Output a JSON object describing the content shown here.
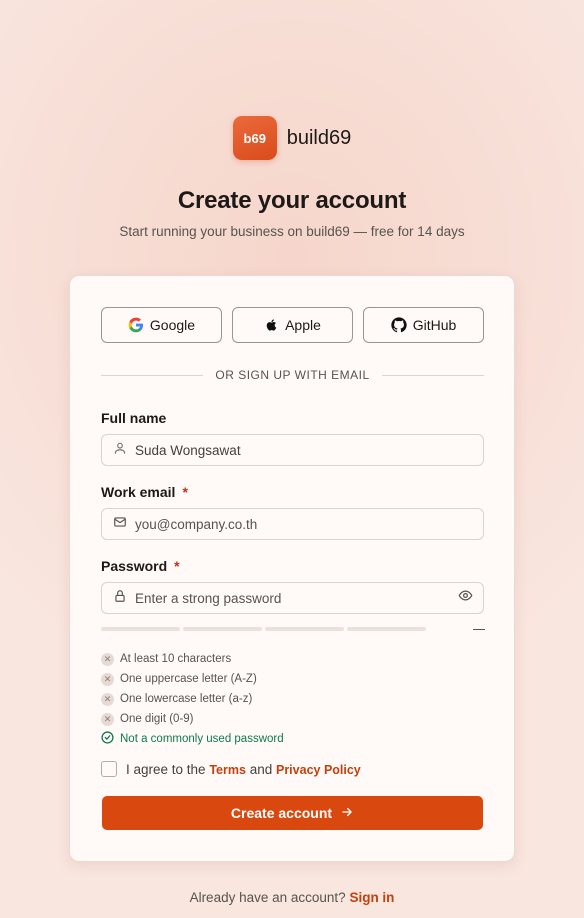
{
  "brand": {
    "logo_text": "b69",
    "name": "build69"
  },
  "header": {
    "title": "Create your account",
    "subtitle": "Start running your business on build69 — free for 14 days"
  },
  "social": {
    "google_label": "Google",
    "apple_label": "Apple",
    "github_label": "GitHub"
  },
  "divider_text": "OR SIGN UP WITH EMAIL",
  "form": {
    "full_name": {
      "label": "Full name",
      "value": "Suda Wongsawat",
      "icon": "user-icon"
    },
    "email": {
      "label": "Work email",
      "required_mark": "*",
      "placeholder": "you@company.co.th",
      "icon": "mail-icon"
    },
    "password": {
      "label": "Password",
      "required_mark": "*",
      "placeholder": "Enter a strong password",
      "icon": "lock-icon",
      "toggle_icon": "eye-icon"
    },
    "strength": {
      "filled_segments": 0,
      "total_segments": 4,
      "label": "—"
    },
    "rules": [
      {
        "text": "At least 10 characters",
        "met": false
      },
      {
        "text": "One uppercase letter (A-Z)",
        "met": false
      },
      {
        "text": "One lowercase letter (a-z)",
        "met": false
      },
      {
        "text": "One digit (0-9)",
        "met": false
      },
      {
        "text": "Not a commonly used password",
        "met": true
      }
    ],
    "agree": {
      "prefix": "I agree to the",
      "terms": "Terms",
      "and": "and",
      "privacy": "Privacy Policy",
      "checked": false
    },
    "submit_label": "Create account"
  },
  "footer": {
    "prompt": "Already have an account?",
    "link": "Sign in"
  },
  "colors": {
    "accent": "#d9480f",
    "success": "#0f7a4e",
    "required": "#c0311a"
  }
}
